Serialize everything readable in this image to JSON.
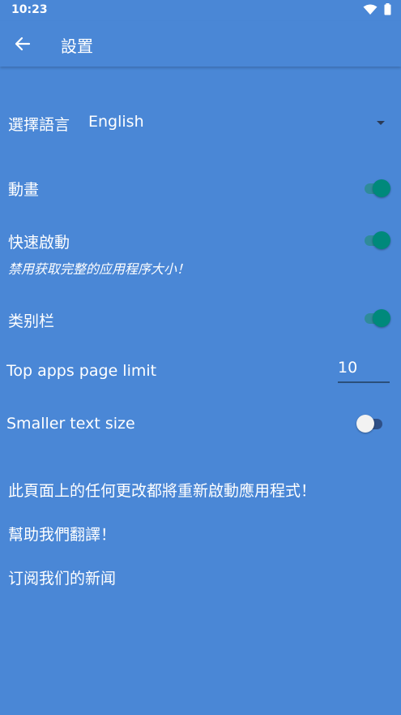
{
  "status": {
    "time": "10:23"
  },
  "appbar": {
    "title": "設置"
  },
  "settings": {
    "language_label": "選擇語言",
    "language_value": "English",
    "animation_label": "動畫",
    "animation_on": true,
    "quick_start_label": "快速啟動",
    "quick_start_note": "禁用获取完整的应用程序大小！",
    "quick_start_on": true,
    "category_bar_label": "类别栏",
    "category_bar_on": true,
    "top_apps_label": "Top apps page limit",
    "top_apps_value": "10",
    "smaller_text_label": "Smaller text size",
    "smaller_text_on": false
  },
  "notice": "此頁面上的任何更改都將重新啟動應用程式！",
  "links": {
    "help_translate": "幫助我們翻譯！",
    "subscribe": "订阅我们的新闻"
  },
  "icons": [
    "back-arrow-icon",
    "wifi-icon",
    "battery-icon",
    "dropdown-arrow-icon"
  ]
}
